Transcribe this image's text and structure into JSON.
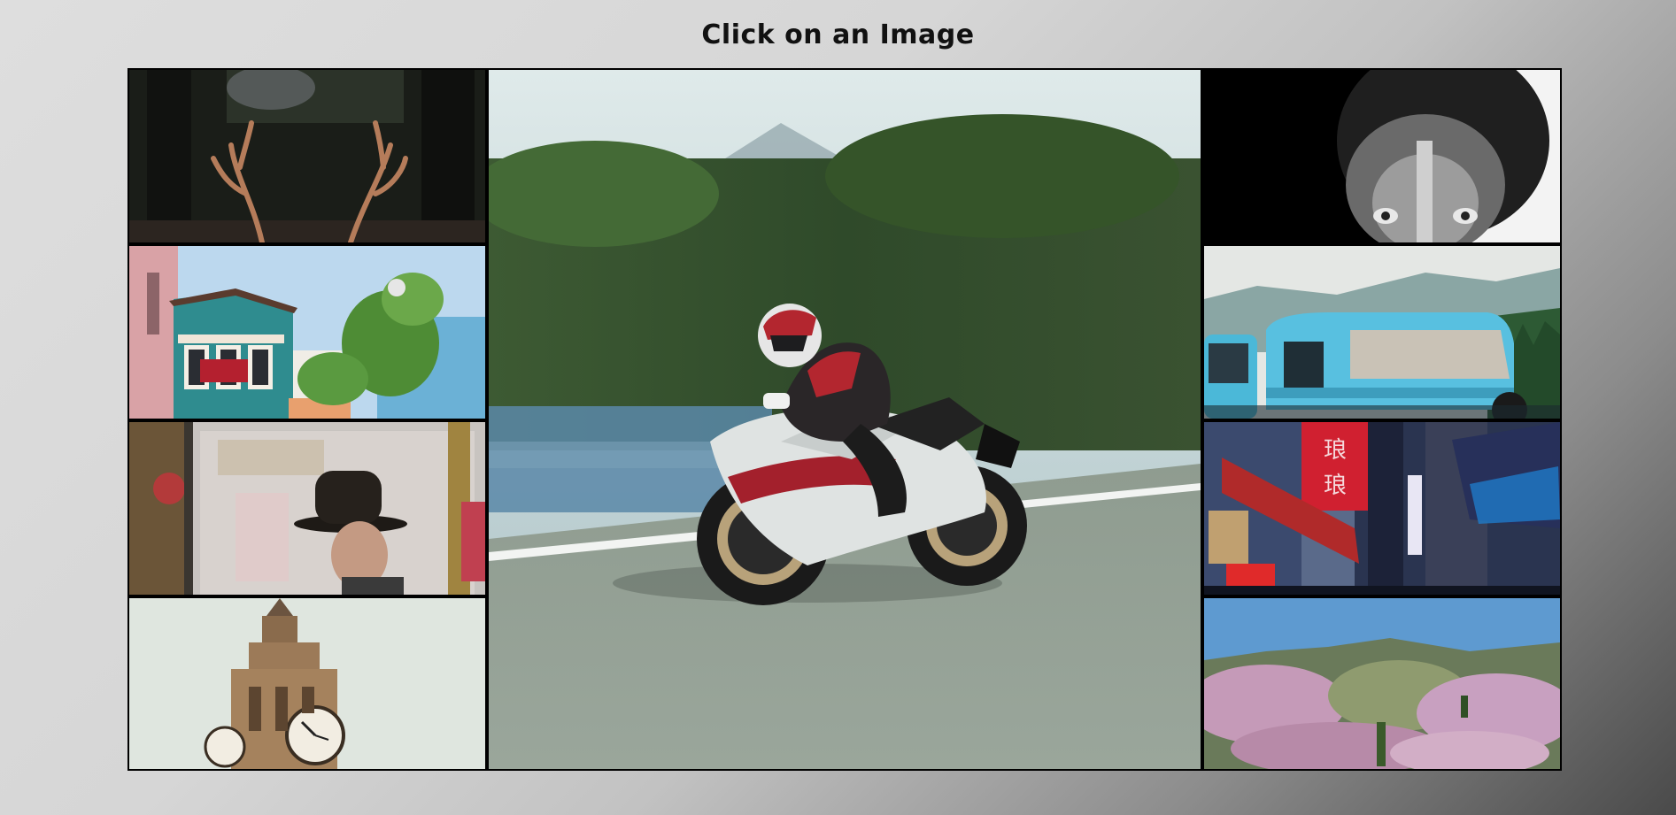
{
  "page": {
    "title": "Click on an Image"
  },
  "gallery": {
    "featured": {
      "subject": "motorcycle rider leaning into a turn"
    },
    "left_thumbnails": [
      {
        "subject": "deer antlers in forest"
      },
      {
        "subject": "colorful townhouses with balcony"
      },
      {
        "subject": "man in bowler hat by shop window"
      },
      {
        "subject": "Big Ben clock tower"
      }
    ],
    "right_thumbnails": [
      {
        "subject": "black and white lion face"
      },
      {
        "subject": "blue van in mountains"
      },
      {
        "subject": "neon signs in narrow street"
      },
      {
        "subject": "pink blossoming hillside"
      }
    ]
  },
  "colors": {
    "border": "#000000",
    "title_text": "#111111"
  }
}
